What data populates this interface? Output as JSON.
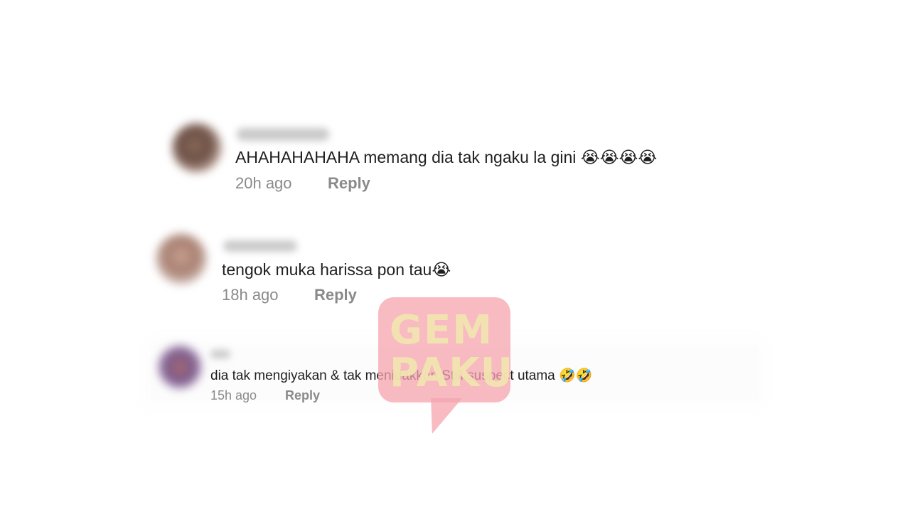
{
  "comments": [
    {
      "text": "AHAHAHAHAHA memang dia tak ngaku la gini 😭😭😭😭",
      "time": "20h ago",
      "reply_label": "Reply"
    },
    {
      "text": "tengok muka harissa pon tau😭",
      "time": "18h ago",
      "reply_label": "Reply"
    },
    {
      "text": "dia tak mengiyakan & tak menidakkan.Still suspect utama 🤣🤣",
      "time": "15h ago",
      "reply_label": "Reply"
    }
  ],
  "watermark": {
    "line1": "GEM",
    "line2": "PAKU"
  },
  "colors": {
    "text": "#1f1f1f",
    "meta": "#8a8a8a",
    "watermark": "#f6a4ad"
  }
}
